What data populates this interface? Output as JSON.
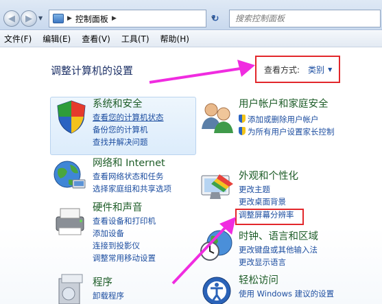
{
  "toolbar": {
    "breadcrumb": [
      "控制面板"
    ],
    "search_placeholder": "搜索控制面板"
  },
  "menubar": {
    "items": [
      "文件(F)",
      "编辑(E)",
      "查看(V)",
      "工具(T)",
      "帮助(H)"
    ]
  },
  "main": {
    "title": "调整计算机的设置",
    "view_by_label": "查看方式:",
    "view_by_value": "类别"
  },
  "categories": {
    "system": {
      "title": "系统和安全",
      "links": [
        "查看您的计算机状态",
        "备份您的计算机",
        "查找并解决问题"
      ]
    },
    "network": {
      "title": "网络和 Internet",
      "links": [
        "查看网络状态和任务",
        "选择家庭组和共享选项"
      ]
    },
    "hardware": {
      "title": "硬件和声音",
      "links": [
        "查看设备和打印机",
        "添加设备",
        "连接到投影仪",
        "调整常用移动设置"
      ]
    },
    "programs": {
      "title": "程序",
      "links": [
        "卸载程序"
      ]
    },
    "users": {
      "title": "用户帐户和家庭安全",
      "links": [
        "添加或删除用户帐户",
        "为所有用户设置家长控制"
      ]
    },
    "appearance": {
      "title": "外观和个性化",
      "links": [
        "更改主题",
        "更改桌面背景",
        "调整屏幕分辨率"
      ]
    },
    "clock": {
      "title": "时钟、语言和区域",
      "links": [
        "更改键盘或其他输入法",
        "更改显示语言"
      ]
    },
    "ease": {
      "title": "轻松访问",
      "links": [
        "使用 Windows 建议的设置"
      ]
    }
  },
  "colors": {
    "highlight_box": "#e2262a",
    "arrow": "#f02ce0",
    "category_title": "#1e5d28",
    "link": "#1d4ea0"
  }
}
